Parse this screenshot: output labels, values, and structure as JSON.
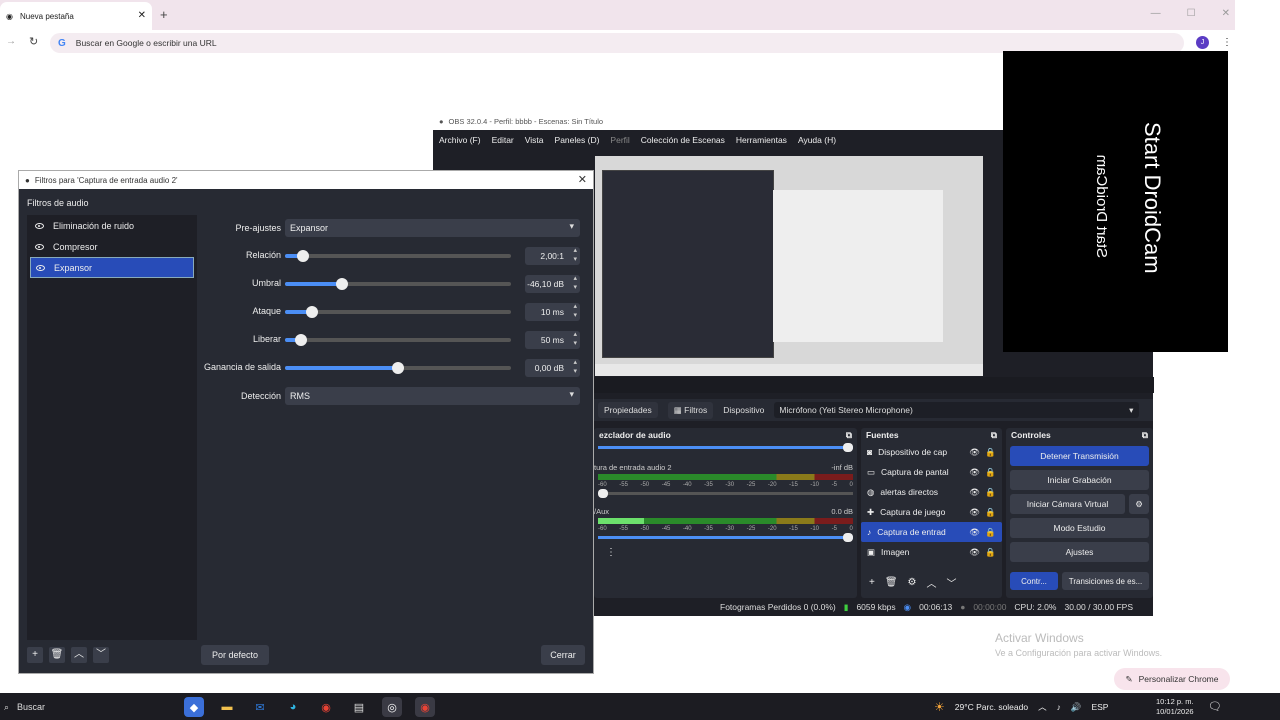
{
  "browser": {
    "tab_title": "Nueva pestaña",
    "omnibox_placeholder": "Buscar en Google o escribir una URL",
    "avatar_letter": "J",
    "customize_label": "Personalizar Chrome"
  },
  "obs": {
    "title": "OBS 32.0.4 - Perfil: bbbb - Escenas: Sin Título",
    "menu": [
      "Archivo (F)",
      "Editar",
      "Vista",
      "Paneles (D)",
      "Perfil",
      "Colección de Escenas",
      "Herramientas",
      "Ayuda (H)"
    ],
    "propbar": {
      "properties": "Propiedades",
      "filters": "Filtros",
      "device_label": "Dispositivo",
      "device_value": "Micrófono (Yeti Stereo Microphone)"
    },
    "mixer": {
      "title": "ezclador de audio",
      "channels": [
        {
          "name": "tura de entrada audio 2",
          "level": "-inf dB"
        },
        {
          "name": "/Aux",
          "level": "0.0 dB"
        }
      ],
      "ticks": [
        "-60",
        "-55",
        "-50",
        "-45",
        "-40",
        "-35",
        "-30",
        "-25",
        "-20",
        "-15",
        "-10",
        "-5",
        "0"
      ]
    },
    "sources": {
      "title": "Fuentes",
      "items": [
        "Dispositivo de cap",
        "Captura de pantal",
        "alertas directos",
        "Captura de juego",
        "Captura de entrad",
        "Imagen"
      ]
    },
    "controls": {
      "title": "Controles",
      "stop_stream": "Detener Transmisión",
      "start_recording": "Iniciar Grabación",
      "start_virtual_cam": "Iniciar Cámara Virtual",
      "studio_mode": "Modo Estudio",
      "settings": "Ajustes",
      "tab_controls": "Contr...",
      "tab_transitions": "Transiciones de es..."
    },
    "status": {
      "dropped": "Fotogramas Perdidos 0 (0.0%)",
      "bitrate": "6059 kbps",
      "stream_time": "00:06:13",
      "rec_time": "00:00:00",
      "cpu": "CPU: 2.0%",
      "fps": "30.00 / 30.00 FPS"
    }
  },
  "droidcam": {
    "line1": "Start DroidCam",
    "line2": "Start DroidCam"
  },
  "filters_dialog": {
    "title": "Filtros para 'Captura de entrada audio 2'",
    "section": "Filtros de audio",
    "filters": [
      {
        "name": "Eliminación de ruido",
        "selected": false
      },
      {
        "name": "Compresor",
        "selected": false
      },
      {
        "name": "Expansor",
        "selected": true
      }
    ],
    "properties": {
      "preset_label": "Pre-ajustes",
      "preset_value": "Expansor",
      "ratio_label": "Relación",
      "ratio_value": "2,00:1",
      "ratio_pct": 8,
      "threshold_label": "Umbral",
      "threshold_value": "-46,10 dB",
      "threshold_pct": 25,
      "attack_label": "Ataque",
      "attack_value": "10 ms",
      "attack_pct": 12,
      "release_label": "Liberar",
      "release_value": "50 ms",
      "release_pct": 7,
      "gain_label": "Ganancia de salida",
      "gain_value": "0,00 dB",
      "gain_pct": 50,
      "detection_label": "Detección",
      "detection_value": "RMS"
    },
    "defaults_button": "Por defecto",
    "close_button": "Cerrar"
  },
  "windows_watermark": {
    "line1": "Activar Windows",
    "line2": "Ve a Configuración para activar Windows."
  },
  "taskbar": {
    "search_label": "Buscar",
    "weather": "29°C  Parc. soleado",
    "language": "ESP",
    "time": "10:12 p. m.",
    "date": "10/01/2026"
  }
}
